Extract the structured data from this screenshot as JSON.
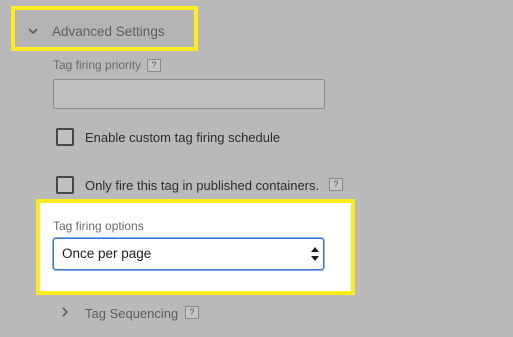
{
  "advanced_settings": {
    "title": "Advanced Settings",
    "expanded": true
  },
  "tag_firing_priority": {
    "label": "Tag firing priority",
    "help": "?",
    "value": "",
    "placeholder": ""
  },
  "custom_schedule": {
    "label": "Enable custom tag firing schedule",
    "checked": false
  },
  "published_only": {
    "label": "Only fire this tag in published containers.",
    "help": "?",
    "checked": false
  },
  "tag_firing_options": {
    "label": "Tag firing options",
    "selected": "Once per page"
  },
  "tag_sequencing": {
    "title": "Tag Sequencing",
    "help": "?",
    "expanded": false
  },
  "colors": {
    "highlight": "#ffeb1f",
    "focus_border": "#3b6fd2",
    "overlay": "#b9b9b9"
  },
  "icons": [
    "chevron-down-icon",
    "help-icon",
    "select-arrows-icon",
    "chevron-right-icon"
  ]
}
